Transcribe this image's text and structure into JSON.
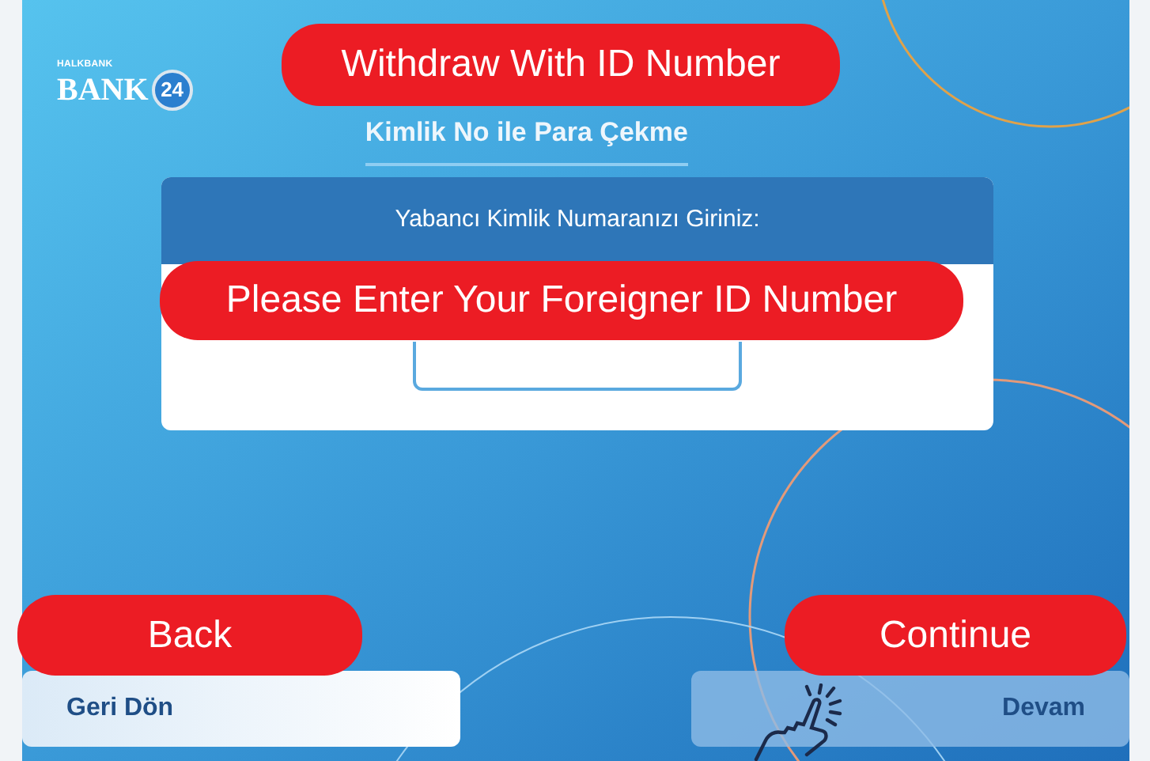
{
  "logo": {
    "brand": "HALKBANK",
    "name": "BANK",
    "number": "24"
  },
  "title": "Kimlik No ile Para Çekme",
  "card": {
    "header": "Yabancı Kimlik Numaranızı Giriniz:"
  },
  "buttons": [
    {
      "label": "Geri Dön",
      "kind": "back",
      "disabled": false
    },
    {
      "label": "Devam",
      "kind": "continue",
      "disabled": true
    }
  ],
  "annotations": [
    {
      "text": "Withdraw With ID Number",
      "kind": "title"
    },
    {
      "text": "Please Enter Your Foreigner ID Number",
      "kind": "field"
    },
    {
      "text": "Back",
      "kind": "back"
    },
    {
      "text": "Continue",
      "kind": "continue"
    }
  ]
}
